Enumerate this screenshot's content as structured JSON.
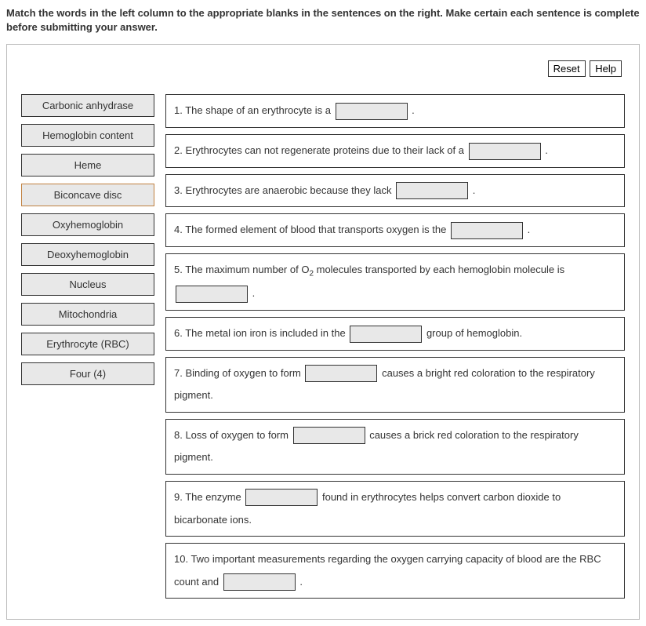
{
  "instructions": "Match the words in the left column to the appropriate blanks in the sentences on the right. Make certain each sentence is complete before submitting your answer.",
  "buttons": {
    "reset": "Reset",
    "help": "Help"
  },
  "terms": [
    {
      "label": "Carbonic anhydrase",
      "selected": false
    },
    {
      "label": "Hemoglobin content",
      "selected": false
    },
    {
      "label": "Heme",
      "selected": false
    },
    {
      "label": "Biconcave disc",
      "selected": true
    },
    {
      "label": "Oxyhemoglobin",
      "selected": false
    },
    {
      "label": "Deoxyhemoglobin",
      "selected": false
    },
    {
      "label": "Nucleus",
      "selected": false
    },
    {
      "label": "Mitochondria",
      "selected": false
    },
    {
      "label": "Erythrocyte (RBC)",
      "selected": false
    },
    {
      "label": "Four (4)",
      "selected": false
    }
  ],
  "sentences": {
    "s1a": "1. The shape of an erythrocyte is a ",
    "s1b": " .",
    "s2a": "2. Erythrocytes can not regenerate proteins due to their lack of a ",
    "s2b": " .",
    "s3a": "3. Erythrocytes are anaerobic because they lack ",
    "s3b": " .",
    "s4a": "4. The formed element of blood that transports oxygen is the ",
    "s4b": " .",
    "s5a": "5. The maximum number of O",
    "s5sub": "2",
    "s5b": " molecules transported by each hemoglobin molecule is ",
    "s5c": " .",
    "s6a": "6. The metal ion iron is included in the ",
    "s6b": " group of hemoglobin.",
    "s7a": "7. Binding of oxygen to form ",
    "s7b": " causes a bright red coloration to the respiratory pigment.",
    "s8a": "8. Loss of oxygen to form ",
    "s8b": " causes a brick red coloration to the respiratory pigment.",
    "s9a": "9. The enzyme ",
    "s9b": " found in erythrocytes helps convert carbon dioxide to bicarbonate ions.",
    "s10a": "10. Two important measurements regarding the oxygen carrying capacity of blood are the RBC count and ",
    "s10b": " ."
  }
}
